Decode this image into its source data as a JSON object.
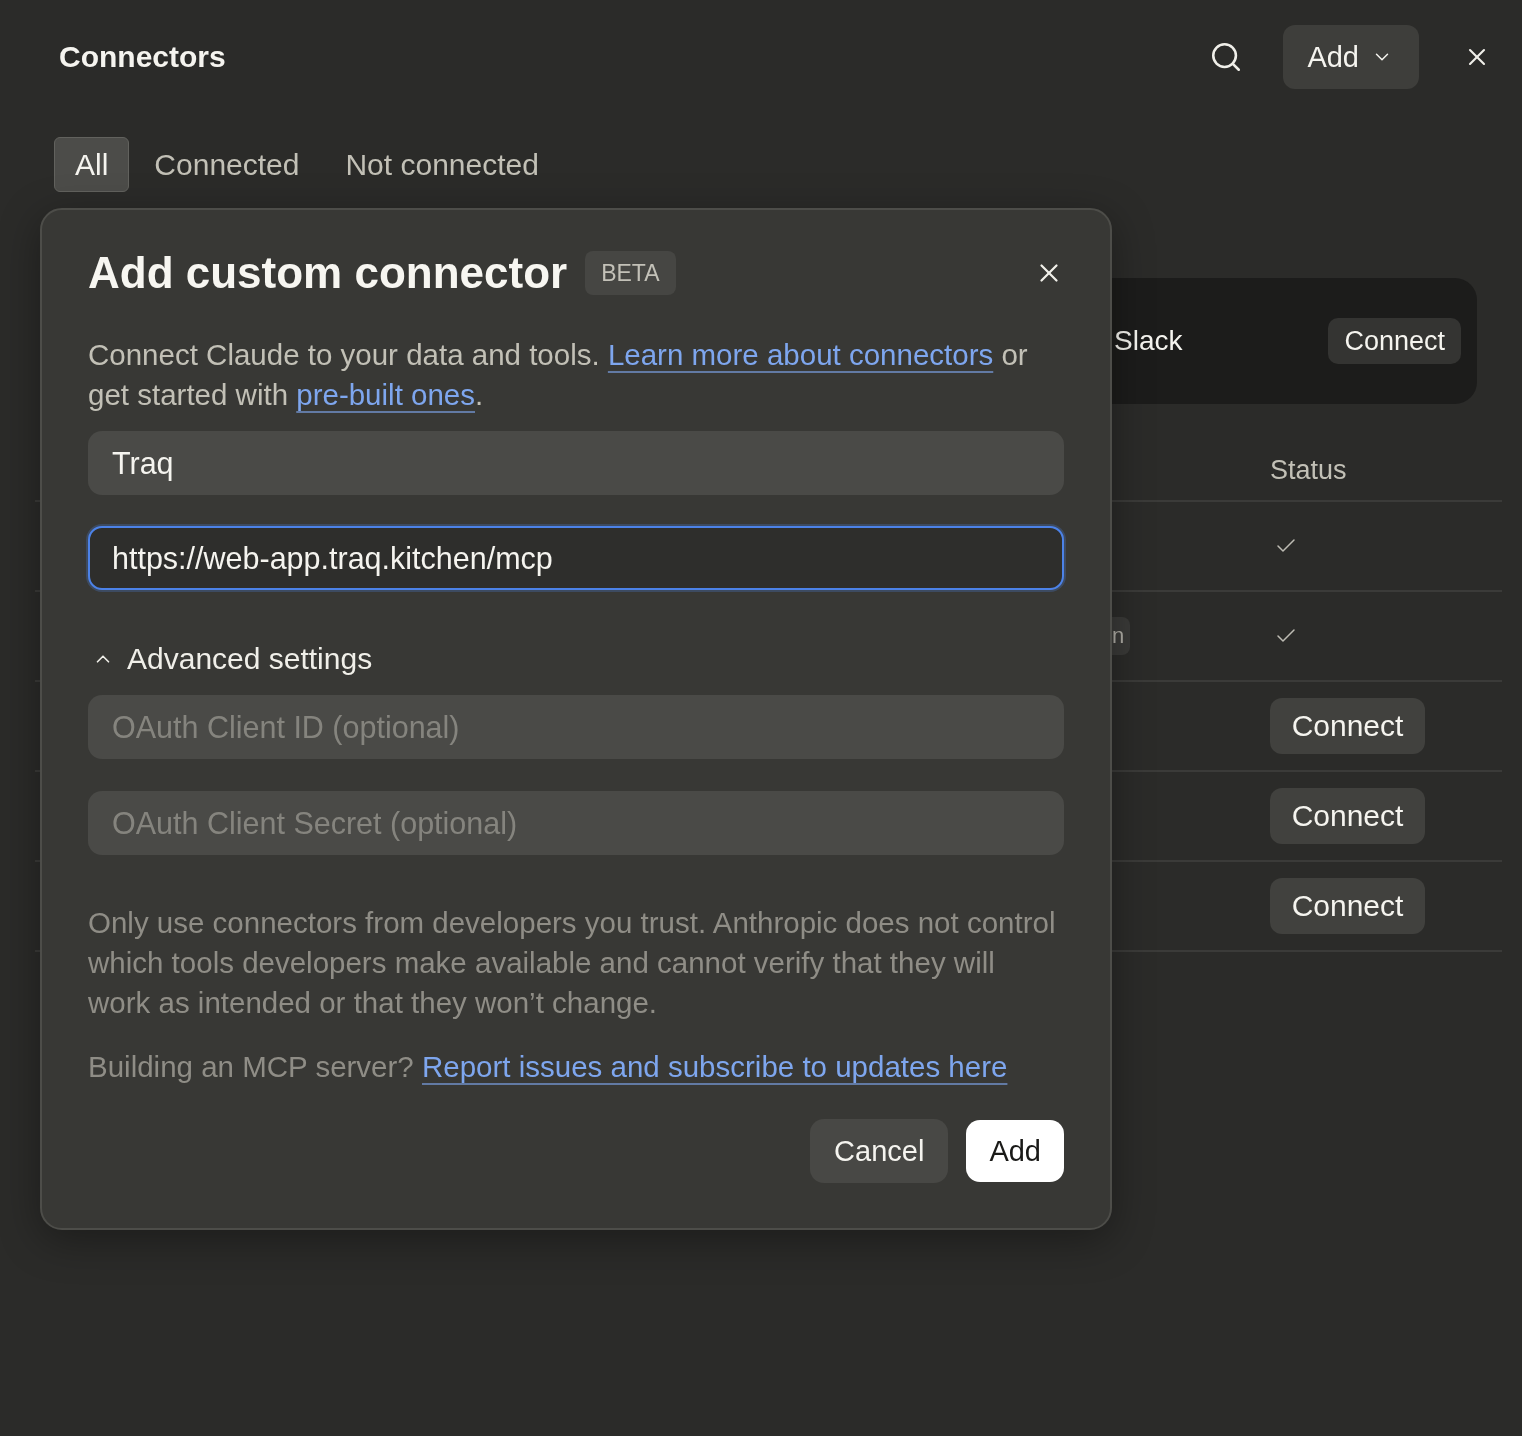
{
  "header": {
    "title": "Connectors",
    "add_button": "Add"
  },
  "tabs": [
    {
      "label": "All",
      "selected": true
    },
    {
      "label": "Connected",
      "selected": false
    },
    {
      "label": "Not connected",
      "selected": false
    }
  ],
  "featured": {
    "name": "Slack",
    "button": "Connect"
  },
  "table": {
    "columns": [
      "Status"
    ],
    "rows": [
      {
        "connected": true
      },
      {
        "tag": "n",
        "connected": true
      },
      {
        "connected": false,
        "button": "Connect"
      },
      {
        "connected": false,
        "button": "Connect"
      },
      {
        "connected": false,
        "button": "Connect"
      }
    ]
  },
  "dialog": {
    "title": "Add custom connector",
    "badge": "BETA",
    "description": [
      {
        "kind": "text",
        "text": "Connect Claude to your data and tools. "
      },
      {
        "kind": "link",
        "text": "Learn more about connectors"
      },
      {
        "kind": "text",
        "text": " or get started with "
      },
      {
        "kind": "link",
        "text": "pre-built ones"
      },
      {
        "kind": "text",
        "text": "."
      }
    ],
    "fields": [
      {
        "value": "Traq",
        "focused": false
      },
      {
        "value": "https://web-app.traq.kitchen/mcp",
        "focused": true
      }
    ],
    "advanced": {
      "label": "Advanced settings",
      "expanded": true,
      "fields": [
        {
          "placeholder": "OAuth Client ID (optional)"
        },
        {
          "placeholder": "OAuth Client Secret (optional)"
        }
      ]
    },
    "warning": "Only use connectors from developers you trust. Anthropic does not control which tools developers make available and cannot verify that they will work as intended or that they won’t change.",
    "note": {
      "text": "Building an MCP server?",
      "link": "Report issues and subscribe to updates here"
    },
    "buttons": [
      {
        "label": "Cancel",
        "kind": "secondary"
      },
      {
        "label": "Add",
        "kind": "primary"
      }
    ]
  }
}
